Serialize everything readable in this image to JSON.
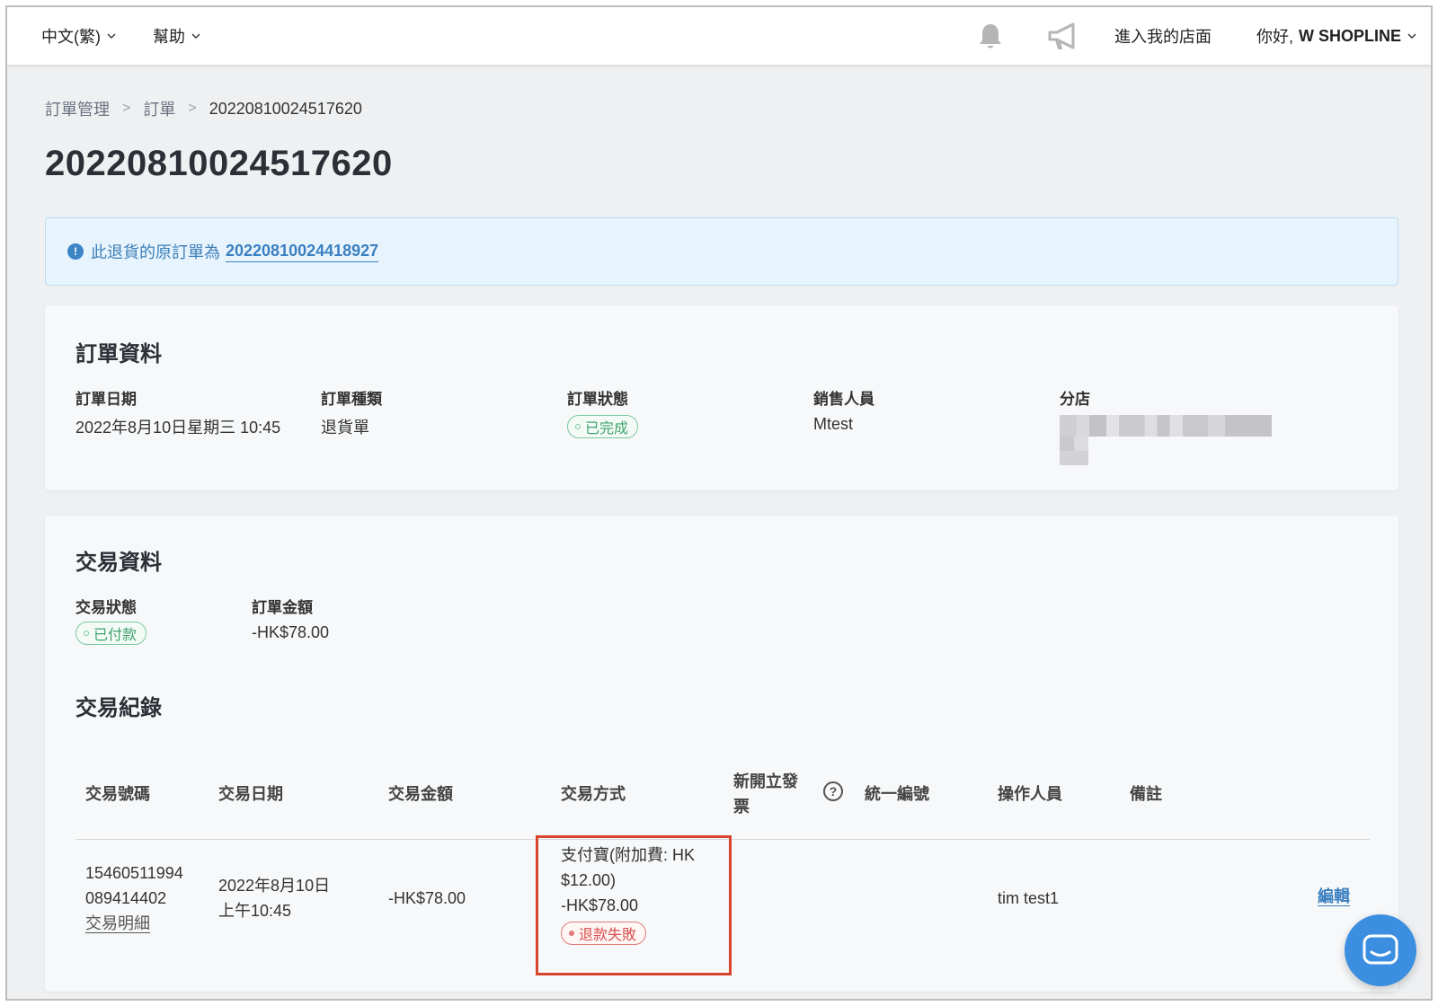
{
  "topbar": {
    "language_label": "中文(繁)",
    "help_label": "幫助",
    "enter_store_label": "進入我的店面",
    "greeting": "你好,",
    "user_name": "W SHOPLINE"
  },
  "breadcrumb": {
    "items": [
      "訂單管理",
      "訂單"
    ],
    "current": "20220810024517620"
  },
  "page_title": "20220810024517620",
  "alert": {
    "text": "此退貨的原訂單為",
    "original_order": "20220810024418927"
  },
  "order_info": {
    "title": "訂單資料",
    "date_label": "訂單日期",
    "date_value": "2022年8月10日星期三 10:45",
    "type_label": "訂單種類",
    "type_value": "退貨單",
    "status_label": "訂單狀態",
    "status_value": "已完成",
    "sales_label": "銷售人員",
    "sales_value": "Mtest",
    "branch_label": "分店"
  },
  "transaction_info": {
    "title": "交易資料",
    "status_label": "交易狀態",
    "status_value": "已付款",
    "amount_label": "訂單金額",
    "amount_value": "-HK$78.00"
  },
  "transaction_records": {
    "title": "交易紀錄",
    "headers": {
      "number": "交易號碼",
      "date": "交易日期",
      "amount": "交易金額",
      "method": "交易方式",
      "invoice_line1": "新開立發",
      "invoice_line2": "票",
      "tax_id": "統一編號",
      "operator": "操作人員",
      "remarks": "備註"
    },
    "rows": [
      {
        "number_line1": "15460511994",
        "number_line2": "089414402",
        "detail_link": "交易明細",
        "date_line1": "2022年8月10日",
        "date_line2": "上午10:45",
        "amount": "-HK$78.00",
        "method_line1": "支付寶(附加費: HK",
        "method_line2": "$12.00)",
        "method_amount": "-HK$78.00",
        "refund_status": "退款失敗",
        "operator": "tim test1",
        "edit_label": "編輯"
      }
    ]
  },
  "colors": {
    "accent": "#3a7fc0",
    "success": "#3fa36d",
    "danger": "#d8504f",
    "highlight": "#d9452c"
  }
}
